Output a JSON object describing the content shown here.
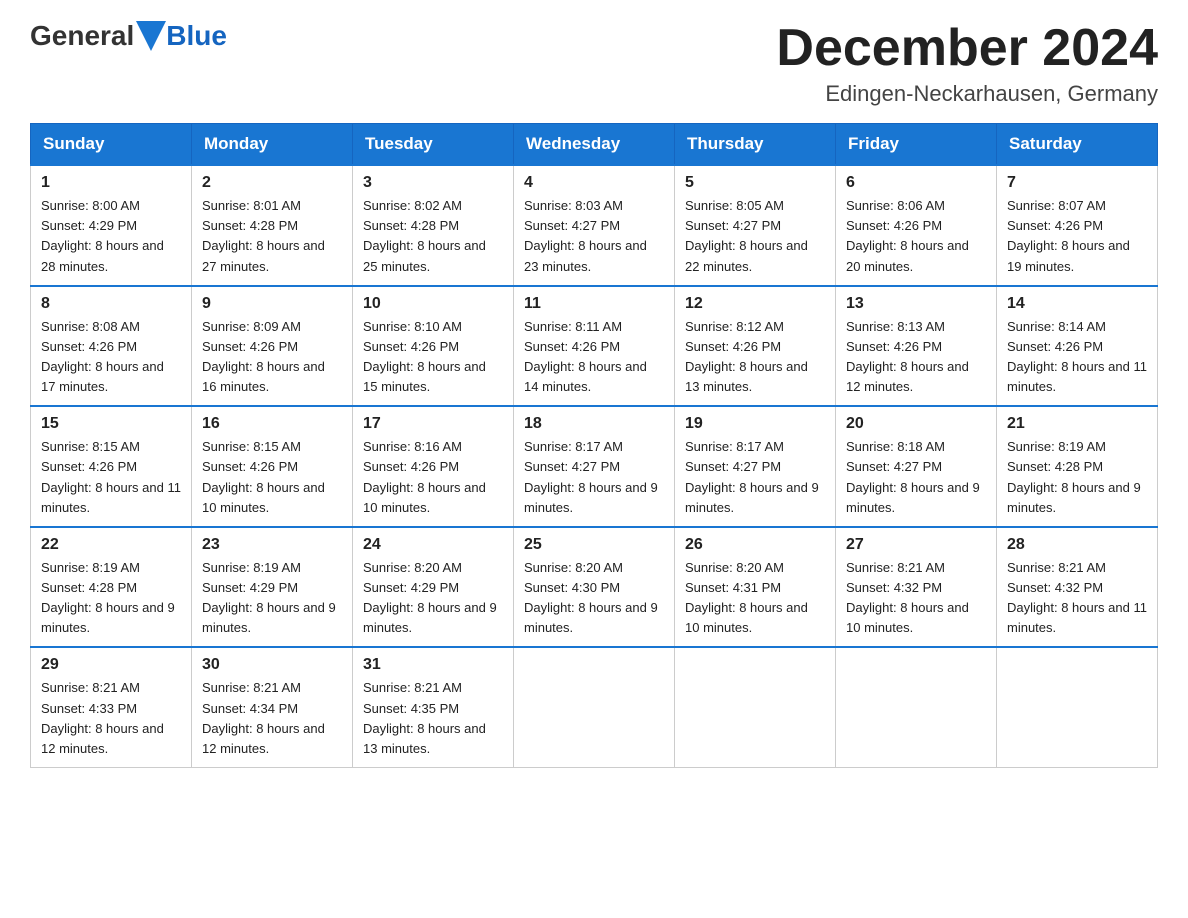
{
  "header": {
    "logo_general": "General",
    "logo_blue": "Blue",
    "month_title": "December 2024",
    "location": "Edingen-Neckarhausen, Germany"
  },
  "days_of_week": [
    "Sunday",
    "Monday",
    "Tuesday",
    "Wednesday",
    "Thursday",
    "Friday",
    "Saturday"
  ],
  "weeks": [
    [
      {
        "day": "1",
        "sunrise": "8:00 AM",
        "sunset": "4:29 PM",
        "daylight": "8 hours and 28 minutes."
      },
      {
        "day": "2",
        "sunrise": "8:01 AM",
        "sunset": "4:28 PM",
        "daylight": "8 hours and 27 minutes."
      },
      {
        "day": "3",
        "sunrise": "8:02 AM",
        "sunset": "4:28 PM",
        "daylight": "8 hours and 25 minutes."
      },
      {
        "day": "4",
        "sunrise": "8:03 AM",
        "sunset": "4:27 PM",
        "daylight": "8 hours and 23 minutes."
      },
      {
        "day": "5",
        "sunrise": "8:05 AM",
        "sunset": "4:27 PM",
        "daylight": "8 hours and 22 minutes."
      },
      {
        "day": "6",
        "sunrise": "8:06 AM",
        "sunset": "4:26 PM",
        "daylight": "8 hours and 20 minutes."
      },
      {
        "day": "7",
        "sunrise": "8:07 AM",
        "sunset": "4:26 PM",
        "daylight": "8 hours and 19 minutes."
      }
    ],
    [
      {
        "day": "8",
        "sunrise": "8:08 AM",
        "sunset": "4:26 PM",
        "daylight": "8 hours and 17 minutes."
      },
      {
        "day": "9",
        "sunrise": "8:09 AM",
        "sunset": "4:26 PM",
        "daylight": "8 hours and 16 minutes."
      },
      {
        "day": "10",
        "sunrise": "8:10 AM",
        "sunset": "4:26 PM",
        "daylight": "8 hours and 15 minutes."
      },
      {
        "day": "11",
        "sunrise": "8:11 AM",
        "sunset": "4:26 PM",
        "daylight": "8 hours and 14 minutes."
      },
      {
        "day": "12",
        "sunrise": "8:12 AM",
        "sunset": "4:26 PM",
        "daylight": "8 hours and 13 minutes."
      },
      {
        "day": "13",
        "sunrise": "8:13 AM",
        "sunset": "4:26 PM",
        "daylight": "8 hours and 12 minutes."
      },
      {
        "day": "14",
        "sunrise": "8:14 AM",
        "sunset": "4:26 PM",
        "daylight": "8 hours and 11 minutes."
      }
    ],
    [
      {
        "day": "15",
        "sunrise": "8:15 AM",
        "sunset": "4:26 PM",
        "daylight": "8 hours and 11 minutes."
      },
      {
        "day": "16",
        "sunrise": "8:15 AM",
        "sunset": "4:26 PM",
        "daylight": "8 hours and 10 minutes."
      },
      {
        "day": "17",
        "sunrise": "8:16 AM",
        "sunset": "4:26 PM",
        "daylight": "8 hours and 10 minutes."
      },
      {
        "day": "18",
        "sunrise": "8:17 AM",
        "sunset": "4:27 PM",
        "daylight": "8 hours and 9 minutes."
      },
      {
        "day": "19",
        "sunrise": "8:17 AM",
        "sunset": "4:27 PM",
        "daylight": "8 hours and 9 minutes."
      },
      {
        "day": "20",
        "sunrise": "8:18 AM",
        "sunset": "4:27 PM",
        "daylight": "8 hours and 9 minutes."
      },
      {
        "day": "21",
        "sunrise": "8:19 AM",
        "sunset": "4:28 PM",
        "daylight": "8 hours and 9 minutes."
      }
    ],
    [
      {
        "day": "22",
        "sunrise": "8:19 AM",
        "sunset": "4:28 PM",
        "daylight": "8 hours and 9 minutes."
      },
      {
        "day": "23",
        "sunrise": "8:19 AM",
        "sunset": "4:29 PM",
        "daylight": "8 hours and 9 minutes."
      },
      {
        "day": "24",
        "sunrise": "8:20 AM",
        "sunset": "4:29 PM",
        "daylight": "8 hours and 9 minutes."
      },
      {
        "day": "25",
        "sunrise": "8:20 AM",
        "sunset": "4:30 PM",
        "daylight": "8 hours and 9 minutes."
      },
      {
        "day": "26",
        "sunrise": "8:20 AM",
        "sunset": "4:31 PM",
        "daylight": "8 hours and 10 minutes."
      },
      {
        "day": "27",
        "sunrise": "8:21 AM",
        "sunset": "4:32 PM",
        "daylight": "8 hours and 10 minutes."
      },
      {
        "day": "28",
        "sunrise": "8:21 AM",
        "sunset": "4:32 PM",
        "daylight": "8 hours and 11 minutes."
      }
    ],
    [
      {
        "day": "29",
        "sunrise": "8:21 AM",
        "sunset": "4:33 PM",
        "daylight": "8 hours and 12 minutes."
      },
      {
        "day": "30",
        "sunrise": "8:21 AM",
        "sunset": "4:34 PM",
        "daylight": "8 hours and 12 minutes."
      },
      {
        "day": "31",
        "sunrise": "8:21 AM",
        "sunset": "4:35 PM",
        "daylight": "8 hours and 13 minutes."
      },
      null,
      null,
      null,
      null
    ]
  ]
}
